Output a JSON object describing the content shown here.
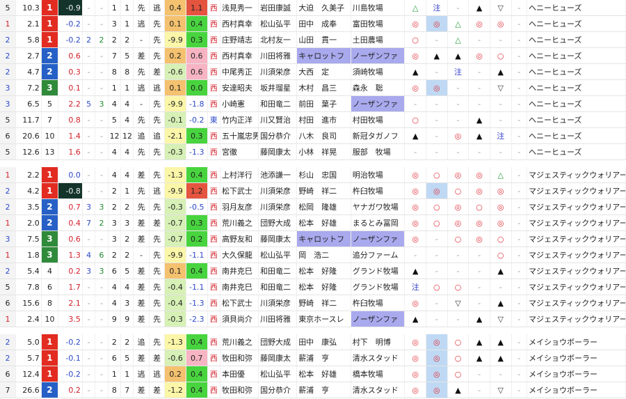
{
  "groups": [
    {
      "sire": "ヘニーヒューズ",
      "rows": [
        {
          "w": "5",
          "odds": "10.3",
          "pop": "1",
          "diff": "-0.9",
          "c5": "-",
          "c6": "-",
          "p1": "1",
          "p2": "1",
          "style": "先",
          "pos": "逃",
          "up": "0.4",
          "up2": "1.1",
          "area": "西",
          "jockey": "浅見秀一",
          "owner": "岩田康誠",
          "trainer": "大迫　久美子",
          "breeder": "川島牧場",
          "m": [
            "△",
            "注",
            "-",
            "▲",
            "▽",
            "-"
          ]
        },
        {
          "w": "1",
          "odds": "2.1",
          "pop": "1",
          "diff": "-0.2",
          "c5": "-",
          "c6": "-",
          "p1": "3",
          "p2": "1",
          "style": "逃",
          "pos": "先",
          "up": "0.1",
          "up2": "0.4",
          "area": "西",
          "jockey": "西村真幸",
          "owner": "松山弘平",
          "trainer": "田中　成奉",
          "breeder": "富田牧場",
          "m": [
            "◎",
            "◎",
            "△",
            "◎",
            "◎",
            "-"
          ]
        },
        {
          "w": "2",
          "odds": "5.8",
          "pop": "1",
          "diff": "-0.2",
          "c5": "2",
          "c6": "2",
          "p1": "2",
          "p2": "2",
          "style": "-",
          "pos": "先",
          "up": "-9.9",
          "up2": "0.3",
          "area": "西",
          "jockey": "庄野靖志",
          "owner": "北村友一",
          "trainer": "山田　貫一",
          "breeder": "土田農場",
          "m": [
            "○",
            "-",
            "△",
            "-",
            "-",
            "-"
          ]
        },
        {
          "w": "2",
          "odds": "2.7",
          "pop": "2",
          "diff": "0.6",
          "c5": "-",
          "c6": "-",
          "p1": "7",
          "p2": "5",
          "style": "差",
          "pos": "先",
          "up": "0.2",
          "up2": "0.6",
          "area": "西",
          "jockey": "西村真幸",
          "owner": "川田将雅",
          "trainer": "キャロットフ",
          "breeder": "ノーザンファ",
          "m": [
            "◎",
            "▲",
            "▲",
            "◎",
            "○",
            "-"
          ]
        },
        {
          "w": "2",
          "odds": "4.7",
          "pop": "2",
          "diff": "0.3",
          "c5": "-",
          "c6": "-",
          "p1": "8",
          "p2": "8",
          "style": "先",
          "pos": "差",
          "up": "-0.6",
          "up2": "0.6",
          "area": "西",
          "jockey": "中尾秀正",
          "owner": "川須栄彦",
          "trainer": "大西　定",
          "breeder": "須崎牧場",
          "m": [
            "▲",
            "-",
            "注",
            "-",
            "▲",
            "-"
          ]
        },
        {
          "w": "3",
          "odds": "7.2",
          "pop": "3",
          "diff": "0.1",
          "c5": "-",
          "c6": "-",
          "p1": "1",
          "p2": "1",
          "style": "逃",
          "pos": "逃",
          "up": "0.1",
          "up2": "0.0",
          "area": "西",
          "jockey": "安達昭夫",
          "owner": "坂井瑠星",
          "trainer": "木村　昌三",
          "breeder": "森永　聡",
          "m": [
            "◎",
            "◎",
            "-",
            "-",
            "▽",
            "-"
          ]
        },
        {
          "w": "3",
          "odds": "6.5",
          "pop": "5",
          "diff": "2.2",
          "c5": "5",
          "c6": "3",
          "p1": "4",
          "p2": "4",
          "style": "-",
          "pos": "先",
          "up": "-9.9",
          "up2": "-1.8",
          "area": "西",
          "jockey": "小崎憲",
          "owner": "和田竜二",
          "trainer": "前田　葉子",
          "breeder": "ノーザンファ",
          "m": [
            "-",
            "-",
            "-",
            "-",
            "-",
            "-"
          ]
        },
        {
          "w": "5",
          "odds": "11.7",
          "pop": "7",
          "diff": "0.8",
          "c5": "-",
          "c6": "-",
          "p1": "5",
          "p2": "4",
          "style": "先",
          "pos": "先",
          "up": "-0.1",
          "up2": "-0.2",
          "area": "東",
          "jockey": "竹内正洋",
          "owner": "川又賢治",
          "trainer": "村田　進市",
          "breeder": "村田牧場",
          "m": [
            "○",
            "-",
            "-",
            "▲",
            "-",
            "-"
          ]
        },
        {
          "w": "6",
          "odds": "20.6",
          "pop": "10",
          "diff": "1.4",
          "c5": "-",
          "c6": "-",
          "p1": "12",
          "p2": "12",
          "style": "追",
          "pos": "追",
          "up": "-2.1",
          "up2": "0.3",
          "area": "西",
          "jockey": "五十嵐忠男",
          "owner": "国分恭介",
          "trainer": "八木　良司",
          "breeder": "新冠タガノフ",
          "m": [
            "▲",
            "-",
            "◎",
            "▲",
            "注",
            "-"
          ]
        },
        {
          "w": "5",
          "odds": "12.6",
          "pop": "13",
          "diff": "1.6",
          "c5": "-",
          "c6": "-",
          "p1": "4",
          "p2": "4",
          "style": "先",
          "pos": "先",
          "up": "-0.3",
          "up2": "-1.3",
          "area": "西",
          "jockey": "宮徹",
          "owner": "藤岡康太",
          "trainer": "小林　祥晃",
          "breeder": "服部　牧場",
          "m": [
            "-",
            "-",
            "-",
            "-",
            "-",
            "-"
          ]
        }
      ]
    },
    {
      "sire": "マジェスティックウォリアー",
      "rows": [
        {
          "w": "1",
          "odds": "2.2",
          "pop": "1",
          "diff": "0.0",
          "c5": "-",
          "c6": "-",
          "p1": "4",
          "p2": "4",
          "style": "差",
          "pos": "先",
          "up": "-1.3",
          "up2": "0.4",
          "area": "西",
          "jockey": "上村洋行",
          "owner": "池添謙一",
          "trainer": "杉山　忠国",
          "breeder": "明治牧場",
          "m": [
            "◎",
            "○",
            "◎",
            "◎",
            "△",
            "-"
          ]
        },
        {
          "w": "2",
          "odds": "4.2",
          "pop": "1",
          "diff": "-0.8",
          "c5": "-",
          "c6": "-",
          "p1": "2",
          "p2": "1",
          "style": "先",
          "pos": "逃",
          "up": "-9.9",
          "up2": "1.2",
          "area": "西",
          "jockey": "松下武士",
          "owner": "川須栄彦",
          "trainer": "野崎　祥二",
          "breeder": "杵臼牧場",
          "m": [
            "◎",
            "◎",
            "○",
            "◎",
            "◎",
            "-"
          ]
        },
        {
          "w": "2",
          "odds": "3.5",
          "pop": "2",
          "diff": "0.7",
          "c5": "3",
          "c6": "3",
          "p1": "2",
          "p2": "2",
          "style": "先",
          "pos": "先",
          "up": "-0.3",
          "up2": "-0.5",
          "area": "西",
          "jockey": "羽月友彦",
          "owner": "川須栄彦",
          "trainer": "松岡　隆雄",
          "breeder": "ヤナガワ牧場",
          "m": [
            "◎",
            "○",
            "◎",
            "○",
            "◎",
            "-"
          ]
        },
        {
          "w": "1",
          "odds": "2.0",
          "pop": "2",
          "diff": "0.4",
          "c5": "7",
          "c6": "2",
          "p1": "3",
          "p2": "3",
          "style": "差",
          "pos": "差",
          "up": "-0.7",
          "up2": "0.3",
          "area": "西",
          "jockey": "荒川義之",
          "owner": "団野大成",
          "trainer": "松本　好雄",
          "breeder": "まるとみ冨岡",
          "m": [
            "◎",
            "○",
            "◎",
            "◎",
            "◎",
            "-"
          ]
        },
        {
          "w": "3",
          "odds": "7.5",
          "pop": "3",
          "diff": "0.6",
          "c5": "-",
          "c6": "-",
          "p1": "3",
          "p2": "2",
          "style": "差",
          "pos": "先",
          "up": "-0.7",
          "up2": "0.2",
          "area": "西",
          "jockey": "高野友和",
          "owner": "藤岡康太",
          "trainer": "キャロットフ",
          "breeder": "ノーザンファ",
          "m": [
            "◎",
            "-",
            "○",
            "◎",
            "○",
            "-"
          ]
        },
        {
          "w": "1",
          "odds": "1.8",
          "pop": "3",
          "diff": "1.3",
          "c5": "4",
          "c6": "6",
          "p1": "2",
          "p2": "2",
          "style": "-",
          "pos": "先",
          "up": "-9.9",
          "up2": "-1.1",
          "area": "西",
          "jockey": "大久保龍",
          "owner": "松山弘平",
          "trainer": "岡　浩二",
          "breeder": "追分ファーム",
          "m": [
            "-",
            "-",
            "-",
            "-",
            "○",
            "-"
          ]
        },
        {
          "w": "2",
          "odds": "5.4",
          "pop": "4",
          "diff": "0.2",
          "c5": "3",
          "c6": "3",
          "p1": "6",
          "p2": "5",
          "style": "差",
          "pos": "先",
          "up": "0.1",
          "up2": "0.4",
          "area": "西",
          "jockey": "南井克巳",
          "owner": "和田竜二",
          "trainer": "松本　好隆",
          "breeder": "グランド牧場",
          "m": [
            "▲",
            "-",
            "-",
            "-",
            "▲",
            "-"
          ]
        },
        {
          "w": "5",
          "odds": "7.8",
          "pop": "6",
          "diff": "1.7",
          "c5": "-",
          "c6": "-",
          "p1": "4",
          "p2": "4",
          "style": "差",
          "pos": "先",
          "up": "-0.4",
          "up2": "-1.1",
          "area": "西",
          "jockey": "南井克巳",
          "owner": "和田竜二",
          "trainer": "松本　好隆",
          "breeder": "グランド牧場",
          "m": [
            "注",
            "○",
            "○",
            "-",
            "-",
            "-"
          ]
        },
        {
          "w": "6",
          "odds": "15.6",
          "pop": "8",
          "diff": "2.1",
          "c5": "-",
          "c6": "-",
          "p1": "4",
          "p2": "3",
          "style": "差",
          "pos": "先",
          "up": "-0.4",
          "up2": "-1.3",
          "area": "西",
          "jockey": "松下武士",
          "owner": "川須栄彦",
          "trainer": "野崎　祥二",
          "breeder": "杵臼牧場",
          "m": [
            "◎",
            "-",
            "▽",
            "-",
            "▲",
            "-"
          ]
        },
        {
          "w": "1",
          "odds": "2.4",
          "pop": "10",
          "diff": "3.5",
          "c5": "-",
          "c6": "-",
          "p1": "9",
          "p2": "9",
          "style": "差",
          "pos": "先",
          "up": "-0.3",
          "up2": "-2.3",
          "area": "西",
          "jockey": "須貝尚介",
          "owner": "川田将雅",
          "trainer": "東京ホースレ",
          "breeder": "ノーザンファ",
          "m": [
            "▲",
            "-",
            "-",
            "▲",
            "▽",
            "-"
          ]
        }
      ]
    },
    {
      "sire": "メイショウボーラー",
      "rows": [
        {
          "w": "2",
          "odds": "5.0",
          "pop": "1",
          "diff": "-0.2",
          "c5": "-",
          "c6": "-",
          "p1": "2",
          "p2": "2",
          "style": "追",
          "pos": "先",
          "up": "-1.3",
          "up2": "0.4",
          "area": "西",
          "jockey": "荒川義之",
          "owner": "団野大成",
          "trainer": "田中　康弘",
          "breeder": "村下　明博",
          "m": [
            "◎",
            "◎",
            "○",
            "▲",
            "▲",
            "-"
          ]
        },
        {
          "w": "2",
          "odds": "5.7",
          "pop": "1",
          "diff": "-0.1",
          "c5": "-",
          "c6": "-",
          "p1": "6",
          "p2": "5",
          "style": "差",
          "pos": "差",
          "up": "-0.6",
          "up2": "0.7",
          "area": "西",
          "jockey": "牧田和弥",
          "owner": "藤岡康太",
          "trainer": "薪浦　亨",
          "breeder": "清水スタッド",
          "m": [
            "◎",
            "◎",
            "○",
            "▲",
            "▲",
            "-"
          ]
        },
        {
          "w": "6",
          "odds": "12.4",
          "pop": "1",
          "diff": "-0.2",
          "c5": "-",
          "c6": "-",
          "p1": "1",
          "p2": "1",
          "style": "逃",
          "pos": "逃",
          "up": "0.2",
          "up2": "0.4",
          "area": "西",
          "jockey": "本田優",
          "owner": "松山弘平",
          "trainer": "松本　好雄",
          "breeder": "橋本牧場",
          "m": [
            "◎",
            "◎",
            "○",
            "-",
            "-",
            "-"
          ]
        },
        {
          "w": "7",
          "odds": "26.6",
          "pop": "2",
          "diff": "0.2",
          "c5": "-",
          "c6": "-",
          "p1": "8",
          "p2": "7",
          "style": "差",
          "pos": "差",
          "up": "-1.2",
          "up2": "0.4",
          "area": "西",
          "jockey": "牧田和弥",
          "owner": "国分恭介",
          "trainer": "薪浦　亨",
          "breeder": "清水スタッド",
          "m": [
            "◎",
            "◎",
            "▲",
            "-",
            "▽",
            "-"
          ]
        }
      ]
    }
  ],
  "colors": {
    "pop1": "#e22b21",
    "pop2": "#2660c6",
    "pop3": "#2f8a3a",
    "highlight": "#a9a9ee",
    "accent_orange": "#f4c16f",
    "accent_green": "#48d43e",
    "accent_red": "#e4543f"
  }
}
